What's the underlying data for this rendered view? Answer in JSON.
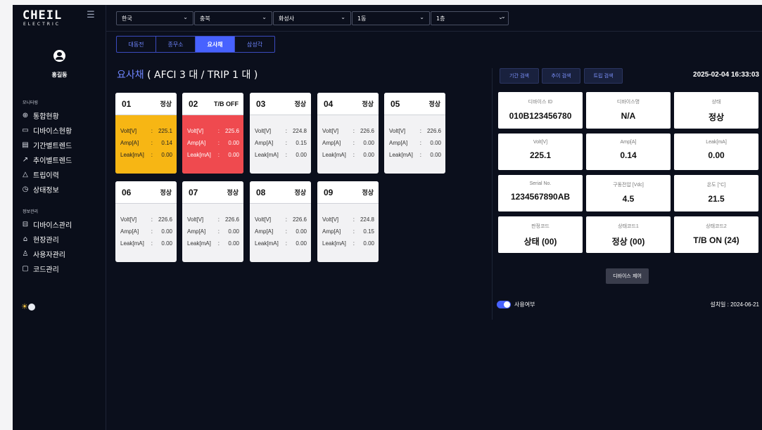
{
  "app": {
    "logo_main": "CHEIL",
    "logo_sub": "ELECTRIC",
    "menu_icon": "hamburger-icon",
    "user_name": "홍길동"
  },
  "sidebar": {
    "group_monitoring": "모니터링",
    "group_info": "정보관리",
    "monitoring_items": [
      {
        "icon": "globe-icon",
        "label": "통합현황"
      },
      {
        "icon": "monitor-icon",
        "label": "디바이스현황"
      },
      {
        "icon": "calendar-icon",
        "label": "기간별트렌드"
      },
      {
        "icon": "trend-icon",
        "label": "추이별트렌드"
      },
      {
        "icon": "warning-icon",
        "label": "트립이력"
      },
      {
        "icon": "clock-icon",
        "label": "상태정보"
      }
    ],
    "info_items": [
      {
        "icon": "device-icon",
        "label": "디바이스관리"
      },
      {
        "icon": "home-icon",
        "label": "현장관리"
      },
      {
        "icon": "users-icon",
        "label": "사용자관리"
      },
      {
        "icon": "folder-icon",
        "label": "코드관리"
      }
    ]
  },
  "filters": [
    {
      "value": "한국"
    },
    {
      "value": "충북"
    },
    {
      "value": "화성사"
    },
    {
      "value": "1동"
    },
    {
      "value": "1층"
    },
    {
      "value": ""
    }
  ],
  "tabs": [
    {
      "label": "대동전",
      "active": false
    },
    {
      "label": "종무소",
      "active": false
    },
    {
      "label": "요사채",
      "active": true
    },
    {
      "label": "삼성각",
      "active": false
    }
  ],
  "main": {
    "title_name": "요사채",
    "title_counts": "( AFCI 3 대 / TRIP 1 대 )"
  },
  "cards": [
    {
      "num": "01",
      "status": "정상",
      "state": "warn",
      "volt": "225.1",
      "amp": "0.14",
      "leak": "0.00"
    },
    {
      "num": "02",
      "status": "T/B OFF",
      "state": "alarm",
      "volt": "225.6",
      "amp": "0.00",
      "leak": "0.00"
    },
    {
      "num": "03",
      "status": "정상",
      "state": "normal",
      "volt": "224.8",
      "amp": "0.15",
      "leak": "0.00"
    },
    {
      "num": "04",
      "status": "정상",
      "state": "normal",
      "volt": "226.6",
      "amp": "0.00",
      "leak": "0.00"
    },
    {
      "num": "05",
      "status": "정상",
      "state": "normal",
      "volt": "226.6",
      "amp": "0.00",
      "leak": "0.00"
    },
    {
      "num": "06",
      "status": "정상",
      "state": "normal",
      "volt": "226.6",
      "amp": "0.00",
      "leak": "0.00"
    },
    {
      "num": "07",
      "status": "정상",
      "state": "normal",
      "volt": "226.6",
      "amp": "0.00",
      "leak": "0.00"
    },
    {
      "num": "08",
      "status": "정상",
      "state": "normal",
      "volt": "226.6",
      "amp": "0.00",
      "leak": "0.00"
    },
    {
      "num": "09",
      "status": "정상",
      "state": "normal",
      "volt": "224.8",
      "amp": "0.15",
      "leak": "0.00"
    }
  ],
  "card_labels": {
    "volt": "Volt[V]",
    "amp": "Amp[A]",
    "leak": "Leak[mA]",
    "sep": ":"
  },
  "panel": {
    "buttons": {
      "period": "기간 검색",
      "trend": "추이 검색",
      "trip": "트립 검색"
    },
    "datetime": "2025-02-04 16:33:03",
    "fields": [
      {
        "key": "디바이스 ID",
        "value": "010B123456780"
      },
      {
        "key": "디바이스명",
        "value": "N/A"
      },
      {
        "key": "상태",
        "value": "정상"
      },
      {
        "key": "Volt[V]",
        "value": "225.1"
      },
      {
        "key": "Amp[A]",
        "value": "0.14"
      },
      {
        "key": "Leak[mA]",
        "value": "0.00"
      },
      {
        "key": "Serial No.",
        "value": "1234567890AB"
      },
      {
        "key": "구동전압 [Vdc]",
        "value": "4.5"
      },
      {
        "key": "온도 [°C]",
        "value": "21.5"
      },
      {
        "key": "판정코드",
        "value": "상태 (00)"
      },
      {
        "key": "상태코드1",
        "value": "정상 (00)"
      },
      {
        "key": "상태코드2",
        "value": "T/B ON (24)"
      }
    ],
    "control_button": "디바이스 제어",
    "use_toggle_label": "사용여부",
    "use_enabled": true,
    "install_date": "설치일 : 2024-06-21"
  },
  "colors": {
    "background": "#0b0f1c",
    "accent": "#4762ff",
    "warn": "#f7b614",
    "alarm": "#ef4a4f"
  }
}
